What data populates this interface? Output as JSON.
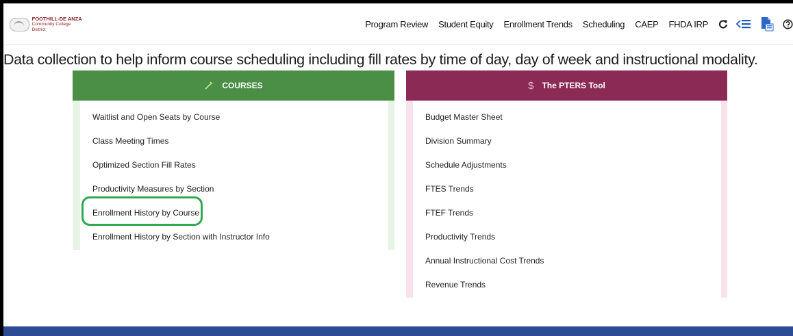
{
  "header": {
    "logo_line1": "FOOTHILL-DE ANZA",
    "logo_line2": "Community College District",
    "nav": [
      "Program Review",
      "Student Equity",
      "Enrollment Trends",
      "Scheduling",
      "CAEP",
      "FHDA IRP"
    ],
    "icons": [
      "refresh-icon",
      "menu-collapse-icon",
      "export-icon",
      "help-icon"
    ]
  },
  "headline": "Data collection to help inform course scheduling including fill rates by time of day, day of week and instructional modality.",
  "courses": {
    "title": "COURSES",
    "icon": "pencil-icon",
    "header_color": "#4b8f47",
    "items": [
      "Waitlist and Open Seats by Course",
      "Class Meeting Times",
      "Optimized Section Fill Rates",
      "Productivity Measures by Section",
      "Enrollment History by Course",
      "Enrollment History by Section with Instructor Info"
    ],
    "highlighted": "Enrollment History by Course"
  },
  "pters": {
    "title": "The PTERS Tool",
    "icon": "dollar-icon",
    "header_color": "#8b2a55",
    "items": [
      "Budget Master Sheet",
      "Division Summary",
      "Schedule Adjustments",
      "FTES Trends",
      "FTEF Trends",
      "Productivity Trends",
      "Annual Instructional Cost Trends",
      "Revenue Trends"
    ]
  }
}
